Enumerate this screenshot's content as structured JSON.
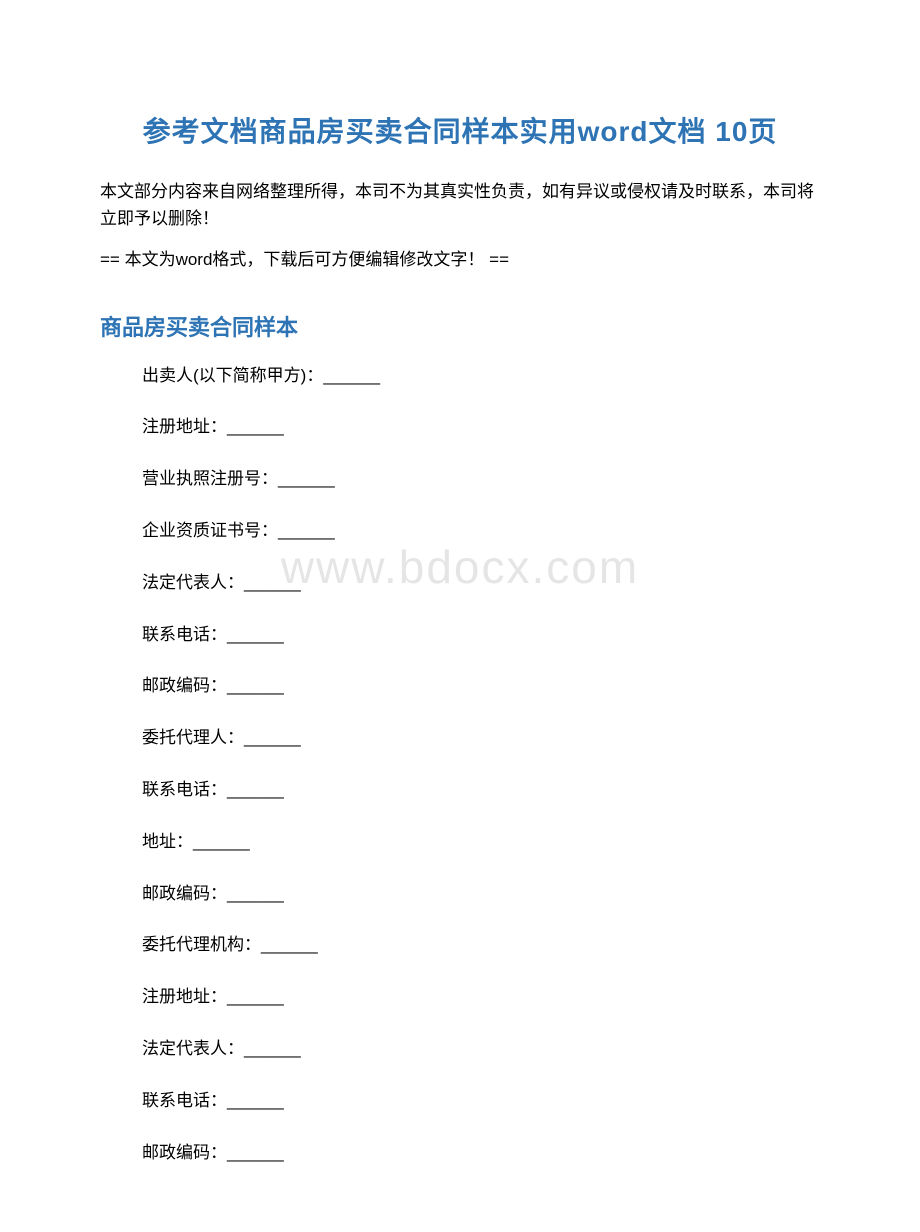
{
  "title": "参考文档商品房买卖合同样本实用word文档 10页",
  "disclaimer": "本文部分内容来自网络整理所得，本司不为其真实性负责，如有异议或侵权请及时联系，本司将立即予以删除！",
  "format_note": "== 本文为word格式，下载后可方便编辑修改文字！ ==",
  "sub_title": "商品房买卖合同样本",
  "watermark": "www.bdocx.com",
  "fields": [
    "出卖人(以下简称甲方)：______",
    "注册地址：______",
    "营业执照注册号：______",
    "企业资质证书号：______",
    "法定代表人：______",
    "联系电话：______",
    "邮政编码：______",
    "委托代理人：______",
    "联系电话：______",
    "地址：______",
    "邮政编码：______",
    "委托代理机构：______",
    "注册地址：______",
    "法定代表人：______",
    "联系电话：______",
    "邮政编码：______"
  ]
}
